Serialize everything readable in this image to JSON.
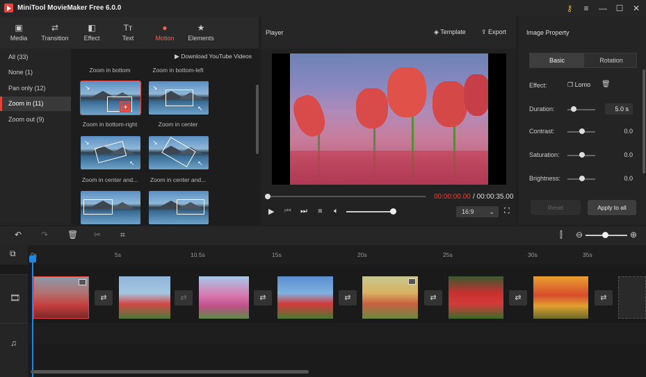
{
  "app": {
    "title": "MiniTool MovieMaker Free 6.0.0"
  },
  "toolbar": [
    {
      "label": "Media",
      "icon": "media-icon",
      "glyph": "▣"
    },
    {
      "label": "Transition",
      "icon": "transition-icon",
      "glyph": "⇄"
    },
    {
      "label": "Effect",
      "icon": "effect-icon",
      "glyph": "◧"
    },
    {
      "label": "Text",
      "icon": "text-icon",
      "glyph": "Tт"
    },
    {
      "label": "Motion",
      "icon": "motion-icon",
      "glyph": "●"
    },
    {
      "label": "Elements",
      "icon": "elements-icon",
      "glyph": "★"
    }
  ],
  "sidebar": [
    {
      "label": "All (33)"
    },
    {
      "label": "None (1)"
    },
    {
      "label": "Pan only (12)"
    },
    {
      "label": "Zoom in (11)"
    },
    {
      "label": "Zoom out (9)"
    }
  ],
  "motion": {
    "download_label": "Download YouTube Videos",
    "items": [
      {
        "label": "Zoom in bottom"
      },
      {
        "label": "Zoom in bottom-left"
      },
      {
        "label": "Zoom in bottom-right"
      },
      {
        "label": "Zoom in center"
      },
      {
        "label": "Zoom in center and..."
      },
      {
        "label": "Zoom in center and..."
      }
    ]
  },
  "player": {
    "title": "Player",
    "template": "Template",
    "export": "Export",
    "current_time": "00:00:00.00",
    "separator": " / ",
    "total_time": "00:00:35.00",
    "ratio": "16:9"
  },
  "property": {
    "title": "Image Property",
    "tab_basic": "Basic",
    "tab_rotation": "Rotation",
    "effect_label": "Effect:",
    "effect_value": "Lomo",
    "duration_label": "Duration:",
    "duration_value": "5.0 s",
    "contrast_label": "Contrast:",
    "contrast_value": "0.0",
    "saturation_label": "Saturation:",
    "saturation_value": "0.0",
    "brightness_label": "Brightness:",
    "brightness_value": "0.0",
    "reset": "Reset",
    "apply_all": "Apply to all"
  },
  "timeline": {
    "ticks": [
      "0s",
      "5s",
      "10.5s",
      "15s",
      "20s",
      "25s",
      "30s",
      "35s"
    ]
  },
  "colors": {
    "accent": "#e8423a",
    "playhead": "#1e88e5"
  }
}
